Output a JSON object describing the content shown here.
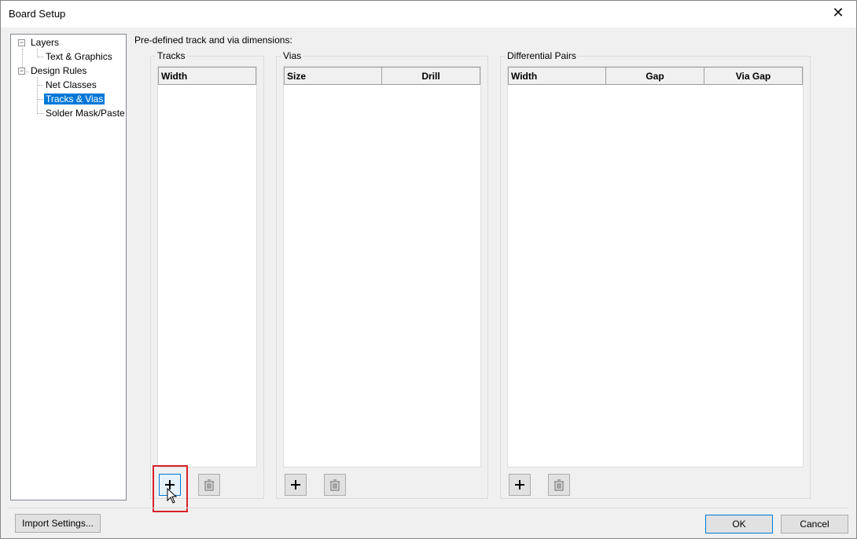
{
  "window": {
    "title": "Board Setup"
  },
  "tree": {
    "items": [
      {
        "label": "Layers",
        "level": 0,
        "expander": "⊟"
      },
      {
        "label": "Text & Graphics",
        "level": 1
      },
      {
        "label": "Design Rules",
        "level": 0,
        "expander": "⊟"
      },
      {
        "label": "Net Classes",
        "level": 1
      },
      {
        "label": "Tracks & Vias",
        "level": 1,
        "selected": true
      },
      {
        "label": "Solder Mask/Paste",
        "level": 1
      }
    ]
  },
  "main": {
    "heading": "Pre-defined track and via dimensions:",
    "tracks": {
      "title": "Tracks",
      "columns": [
        "Width"
      ]
    },
    "vias": {
      "title": "Vias",
      "columns": [
        "Size",
        "Drill"
      ]
    },
    "diff_pairs": {
      "title": "Differential Pairs",
      "columns": [
        "Width",
        "Gap",
        "Via Gap"
      ]
    },
    "add_icon": "plus-icon",
    "delete_icon": "trash-icon"
  },
  "footer": {
    "import_label": "Import Settings...",
    "ok_label": "OK",
    "cancel_label": "Cancel"
  },
  "colors": {
    "selection": "#0078d7",
    "annotation": "#d8212a"
  }
}
